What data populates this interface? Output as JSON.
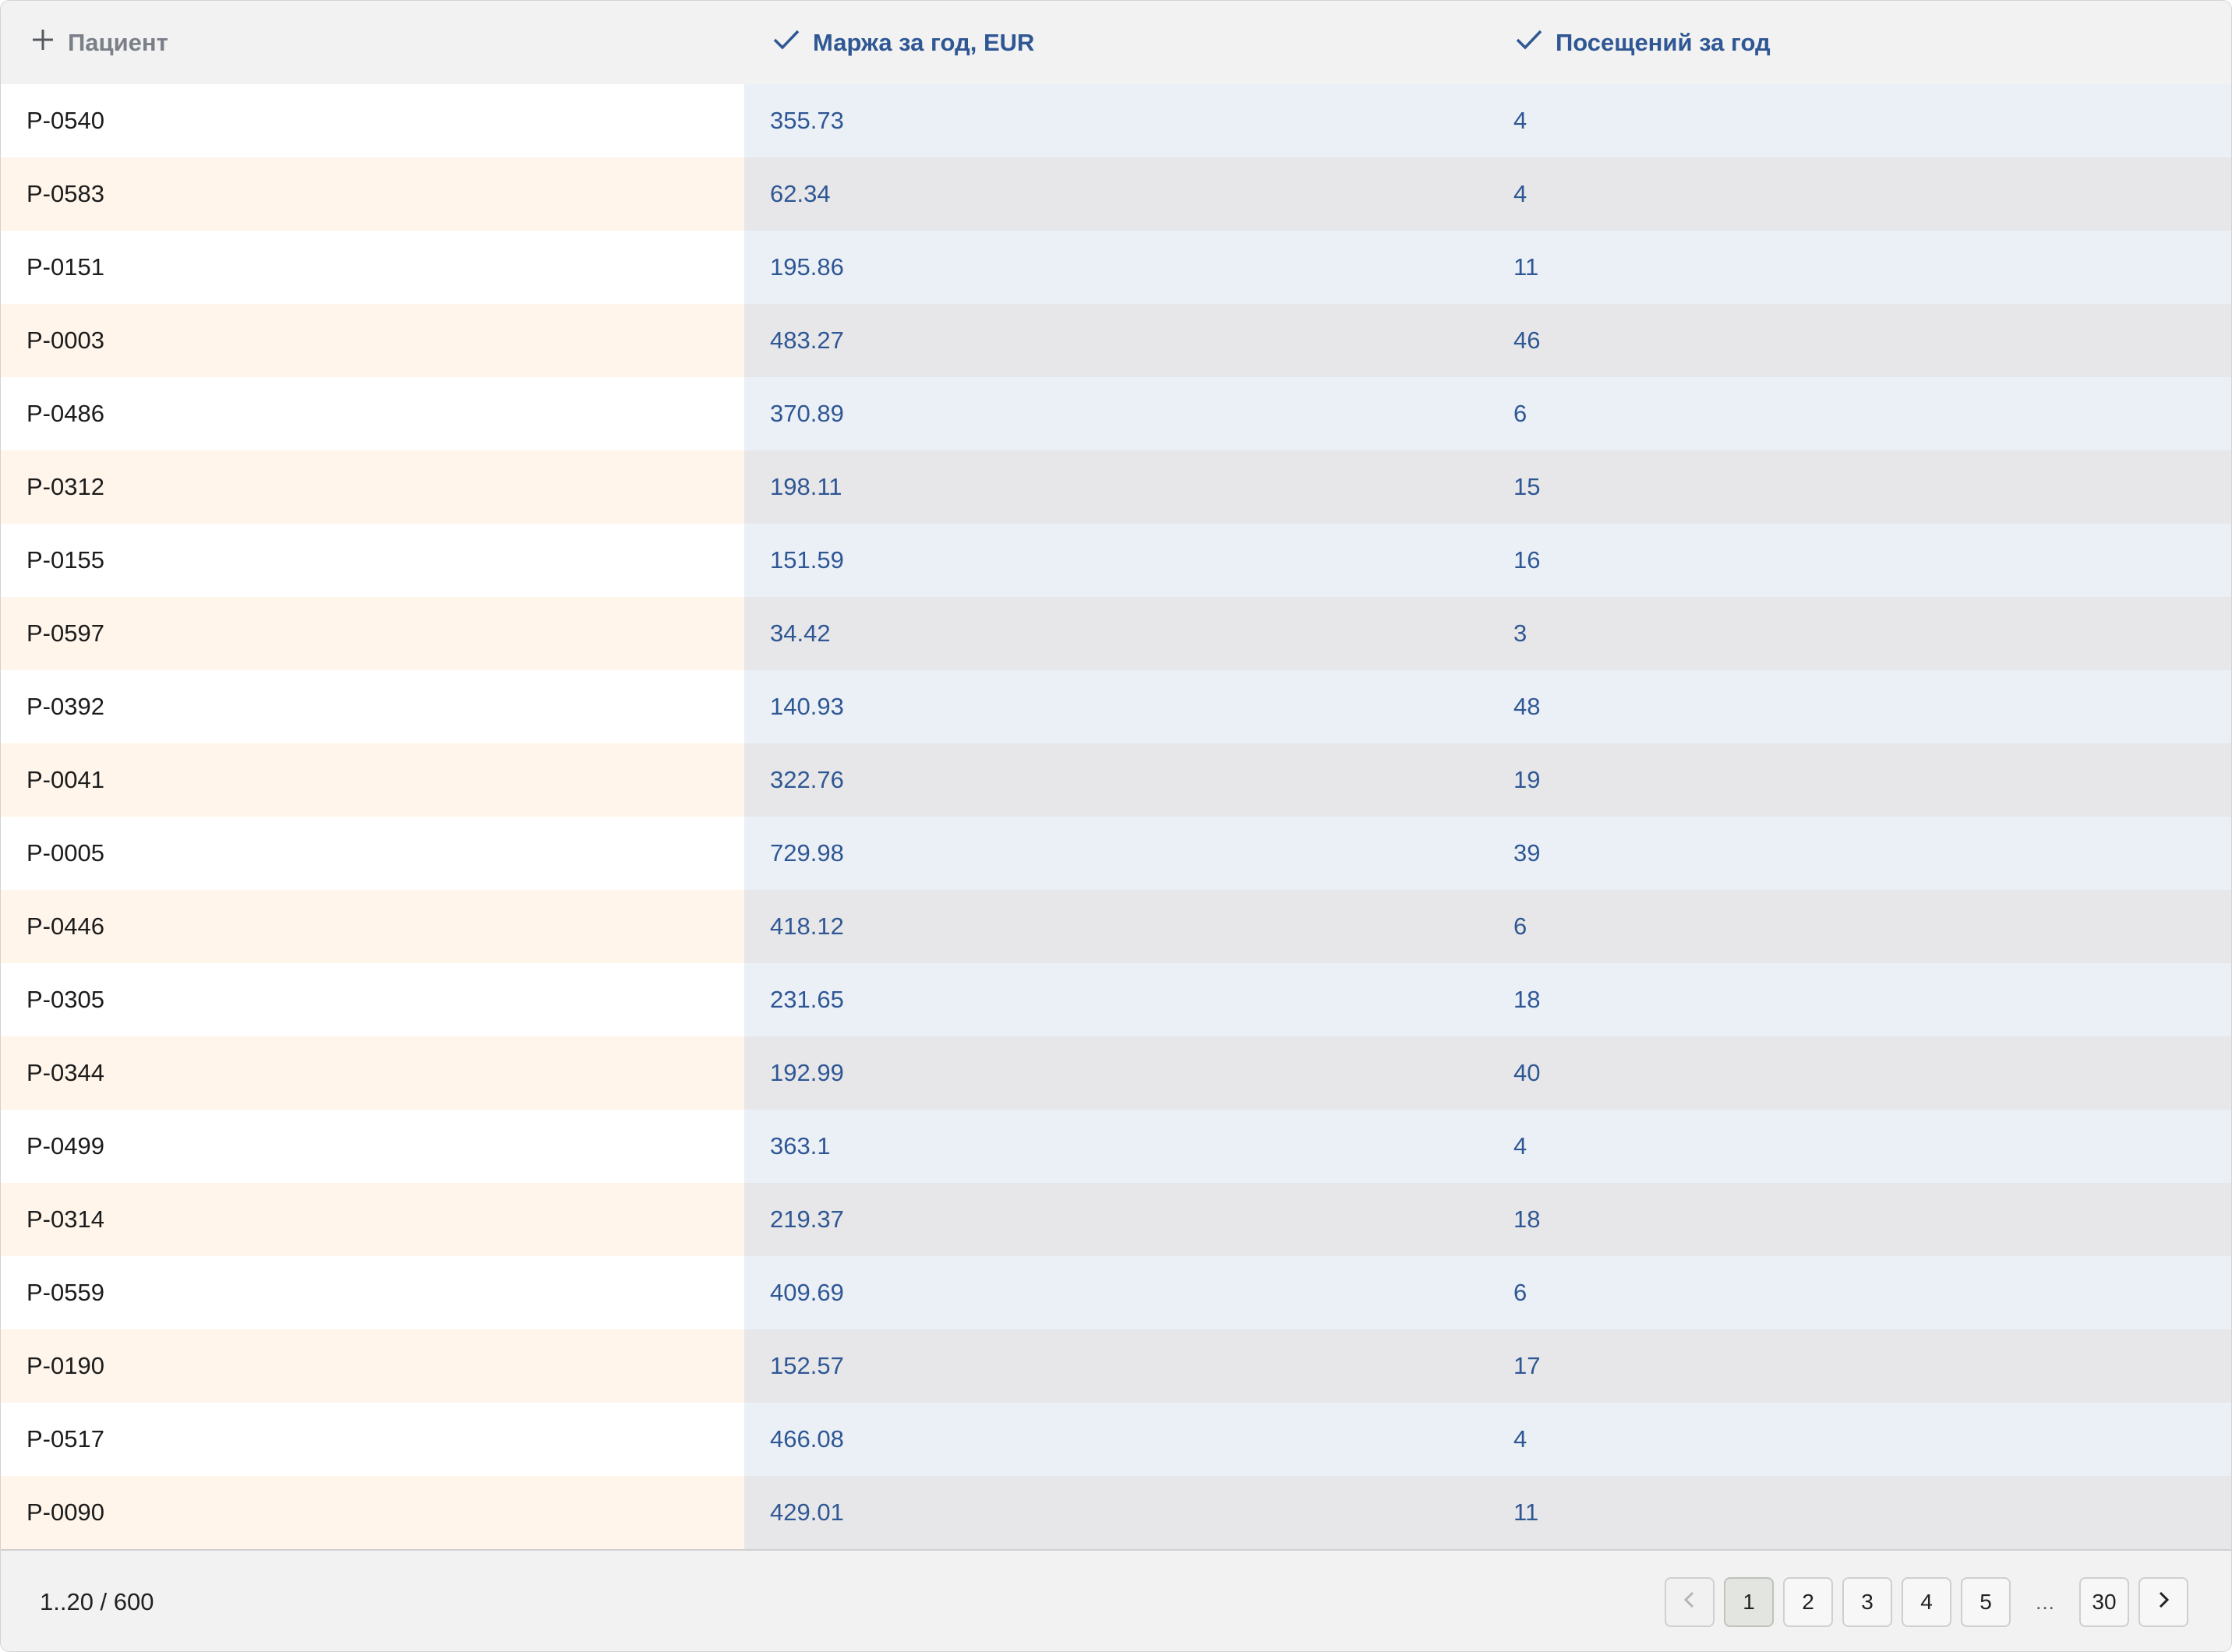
{
  "header": {
    "col_patient": "Пациент",
    "col_margin": "Маржа за год, EUR",
    "col_visits": "Посещений за год"
  },
  "rows": [
    {
      "patient": "P-0540",
      "margin": "355.73",
      "visits": "4"
    },
    {
      "patient": "P-0583",
      "margin": "62.34",
      "visits": "4"
    },
    {
      "patient": "P-0151",
      "margin": "195.86",
      "visits": "11"
    },
    {
      "patient": "P-0003",
      "margin": "483.27",
      "visits": "46"
    },
    {
      "patient": "P-0486",
      "margin": "370.89",
      "visits": "6"
    },
    {
      "patient": "P-0312",
      "margin": "198.11",
      "visits": "15"
    },
    {
      "patient": "P-0155",
      "margin": "151.59",
      "visits": "16"
    },
    {
      "patient": "P-0597",
      "margin": "34.42",
      "visits": "3"
    },
    {
      "patient": "P-0392",
      "margin": "140.93",
      "visits": "48"
    },
    {
      "patient": "P-0041",
      "margin": "322.76",
      "visits": "19"
    },
    {
      "patient": "P-0005",
      "margin": "729.98",
      "visits": "39"
    },
    {
      "patient": "P-0446",
      "margin": "418.12",
      "visits": "6"
    },
    {
      "patient": "P-0305",
      "margin": "231.65",
      "visits": "18"
    },
    {
      "patient": "P-0344",
      "margin": "192.99",
      "visits": "40"
    },
    {
      "patient": "P-0499",
      "margin": "363.1",
      "visits": "4"
    },
    {
      "patient": "P-0314",
      "margin": "219.37",
      "visits": "18"
    },
    {
      "patient": "P-0559",
      "margin": "409.69",
      "visits": "6"
    },
    {
      "patient": "P-0190",
      "margin": "152.57",
      "visits": "17"
    },
    {
      "patient": "P-0517",
      "margin": "466.08",
      "visits": "4"
    },
    {
      "patient": "P-0090",
      "margin": "429.01",
      "visits": "11"
    }
  ],
  "footer": {
    "range": "1..20 / 600",
    "pages": [
      "1",
      "2",
      "3",
      "4",
      "5"
    ],
    "ellipsis": "…",
    "last_page": "30",
    "active_page": "1"
  },
  "icons": {
    "patient_col": "plus-icon",
    "margin_col": "check-icon",
    "visits_col": "check-icon",
    "prev": "chevron-left-icon",
    "next": "chevron-right-icon"
  },
  "colors": {
    "value_text": "#2f5794",
    "patient_row_alt": "#fff5ea",
    "value_row": "#ebf0f7",
    "value_row_alt": "#e7e7e9"
  }
}
